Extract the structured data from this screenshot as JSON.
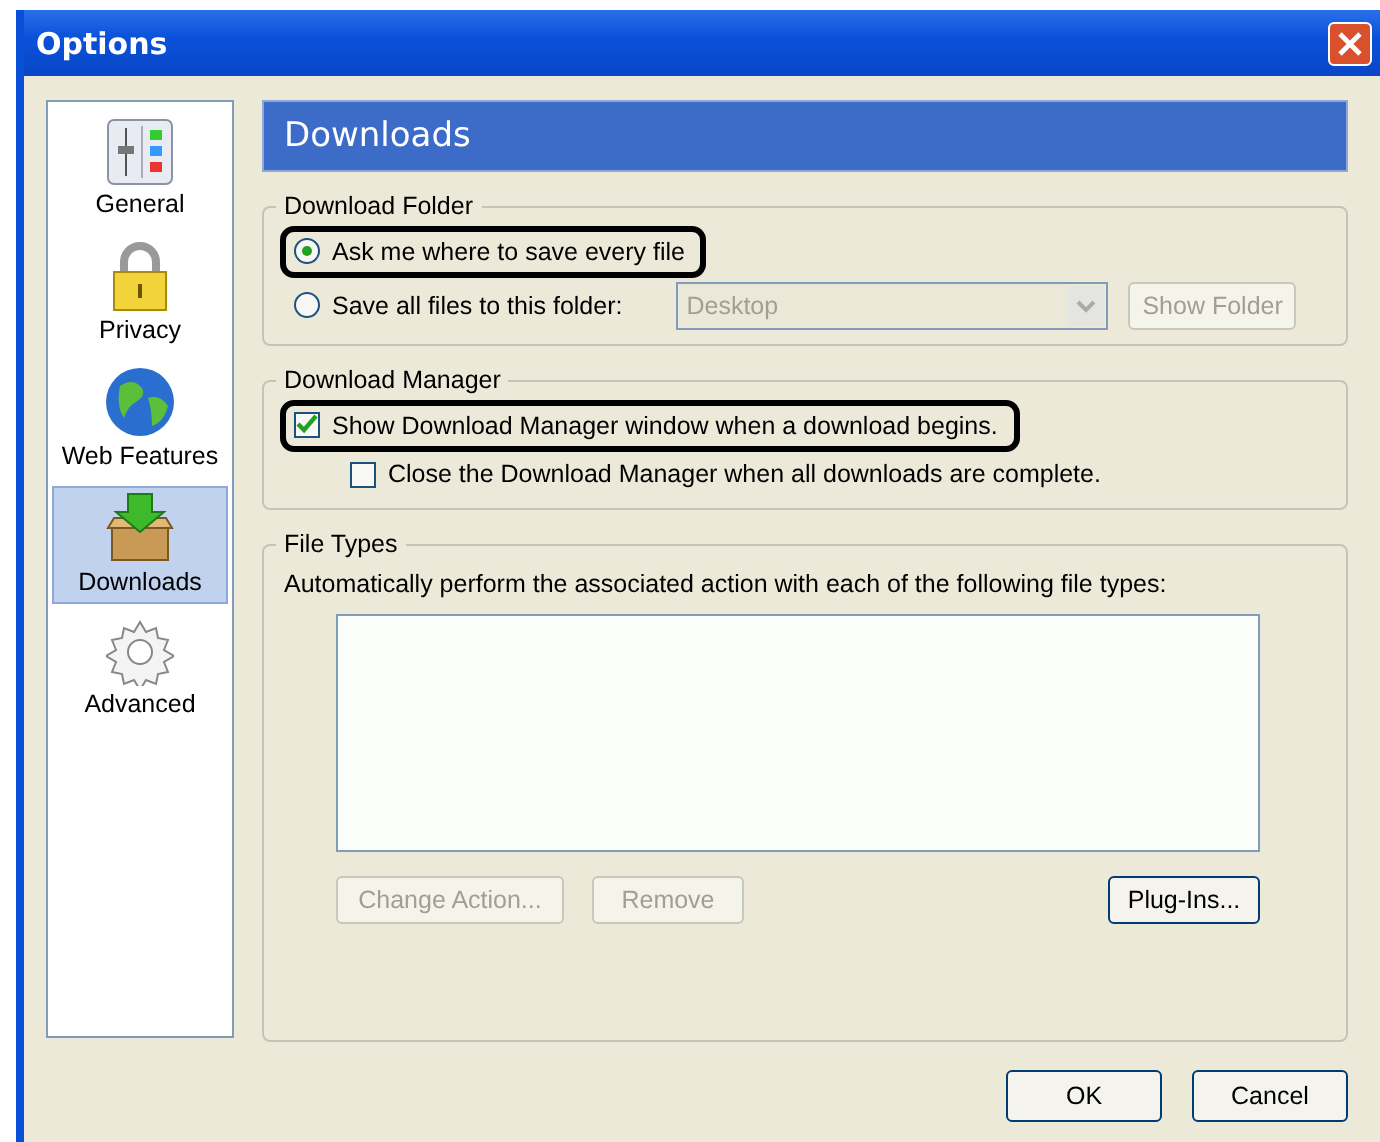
{
  "window": {
    "title": "Options"
  },
  "sidebar": {
    "items": [
      {
        "label": "General",
        "selected": false
      },
      {
        "label": "Privacy",
        "selected": false
      },
      {
        "label": "Web Features",
        "selected": false
      },
      {
        "label": "Downloads",
        "selected": true
      },
      {
        "label": "Advanced",
        "selected": false
      }
    ]
  },
  "panel": {
    "title": "Downloads",
    "download_folder": {
      "legend": "Download Folder",
      "options": [
        {
          "label": "Ask me where to save every file",
          "selected": true,
          "highlighted": true
        },
        {
          "label": "Save all files to this folder:",
          "selected": false,
          "highlighted": false
        }
      ],
      "folder_dropdown": {
        "value": "Desktop",
        "disabled": true
      },
      "show_folder_button": {
        "label": "Show Folder",
        "disabled": true
      }
    },
    "download_manager": {
      "legend": "Download Manager",
      "checkboxes": [
        {
          "label": "Show Download Manager window when a download begins.",
          "checked": true,
          "highlighted": true,
          "indented": false
        },
        {
          "label": "Close the Download Manager when all downloads are complete.",
          "checked": false,
          "highlighted": false,
          "indented": true
        }
      ]
    },
    "file_types": {
      "legend": "File Types",
      "description": "Automatically perform the associated action with each of the following file types:",
      "buttons": [
        {
          "label": "Change Action...",
          "disabled": true
        },
        {
          "label": "Remove",
          "disabled": true
        },
        {
          "label": "Plug-Ins...",
          "disabled": false
        }
      ]
    }
  },
  "dialog_buttons": [
    {
      "label": "OK"
    },
    {
      "label": "Cancel"
    }
  ]
}
